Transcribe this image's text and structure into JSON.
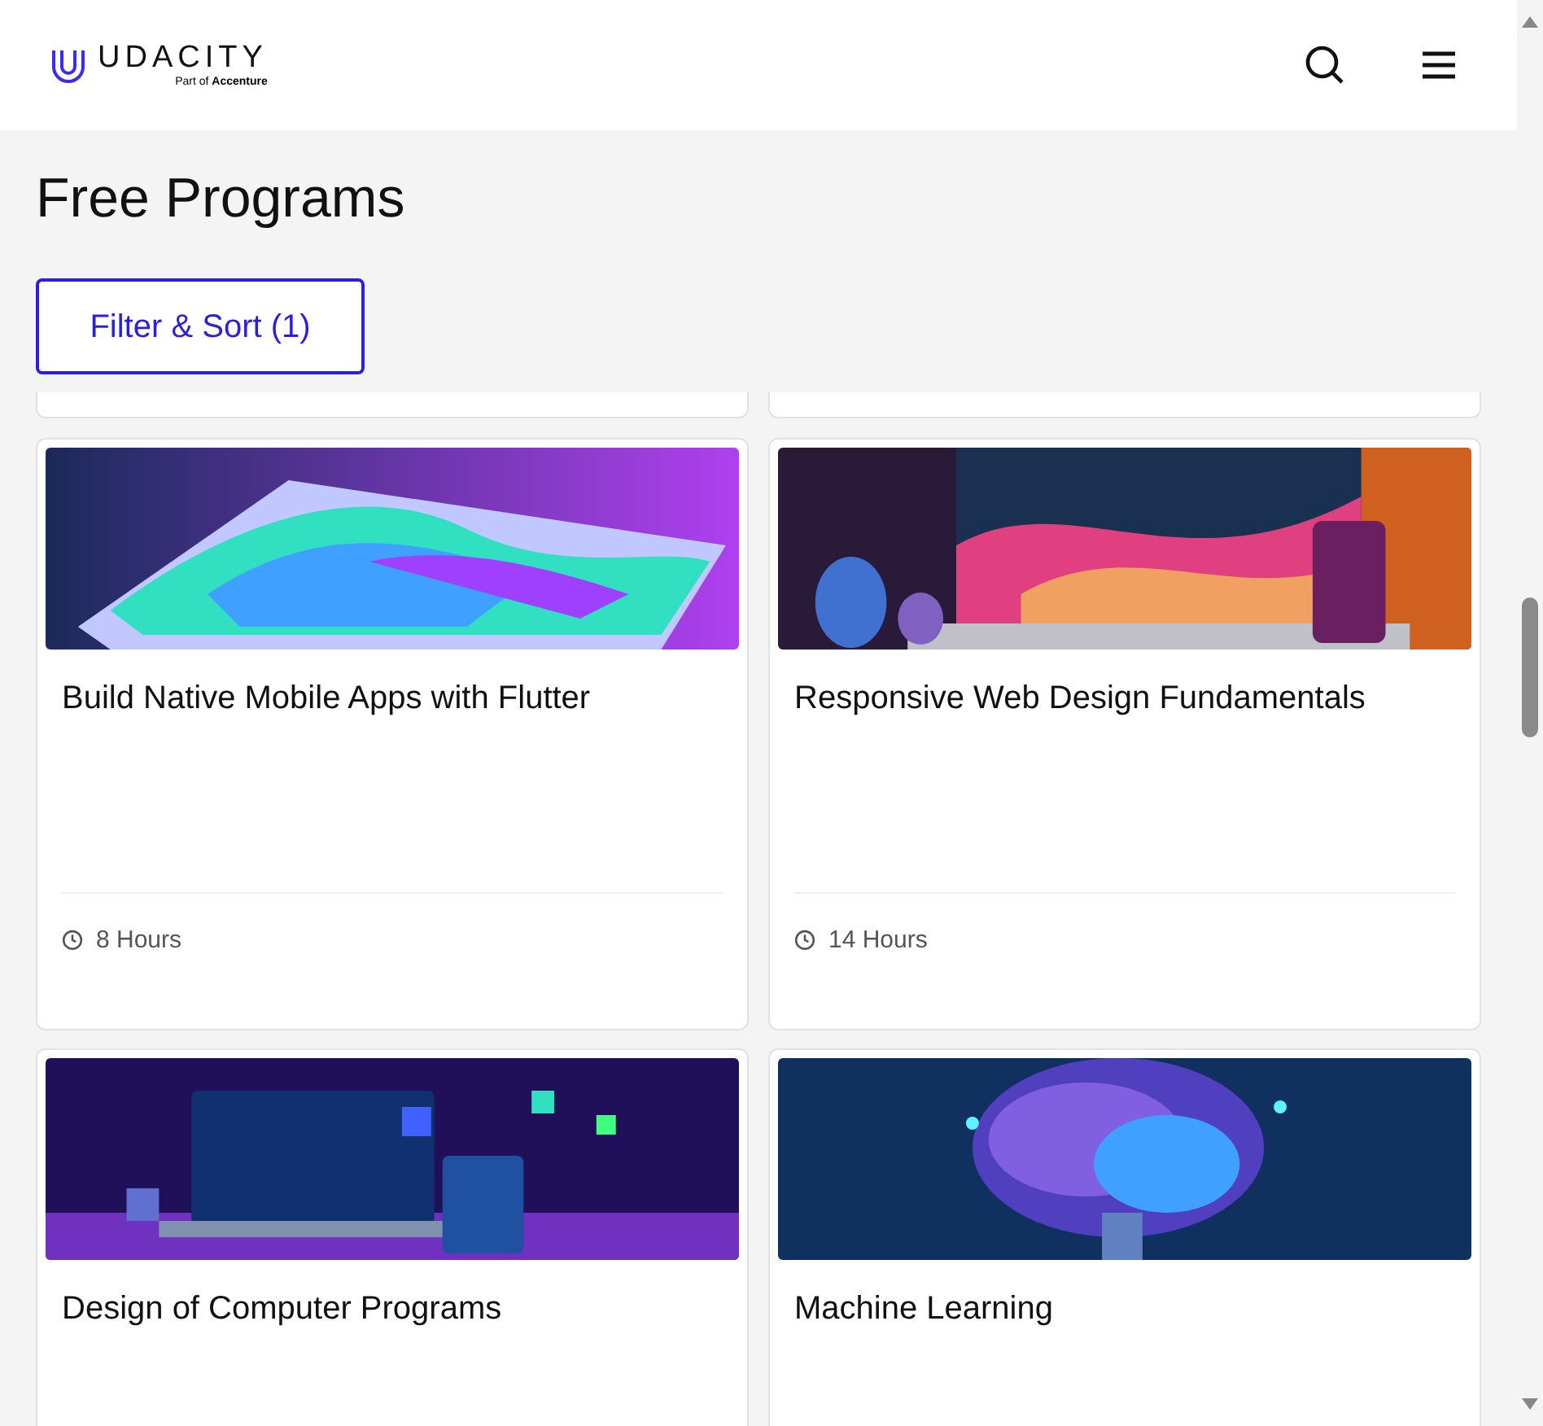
{
  "header": {
    "brand": "UDACITY",
    "tagline": "Part of",
    "tagline_bold": "Accenture"
  },
  "title": "Free Programs",
  "filter_button": "Filter & Sort (1)",
  "programs": [
    {
      "title": "Build Native Mobile Apps with Flutter",
      "duration": "8 Hours"
    },
    {
      "title": "Responsive Web Design Fundamentals",
      "duration": "14 Hours"
    },
    {
      "title": "Design of Computer Programs"
    },
    {
      "title": "Machine Learning"
    }
  ]
}
